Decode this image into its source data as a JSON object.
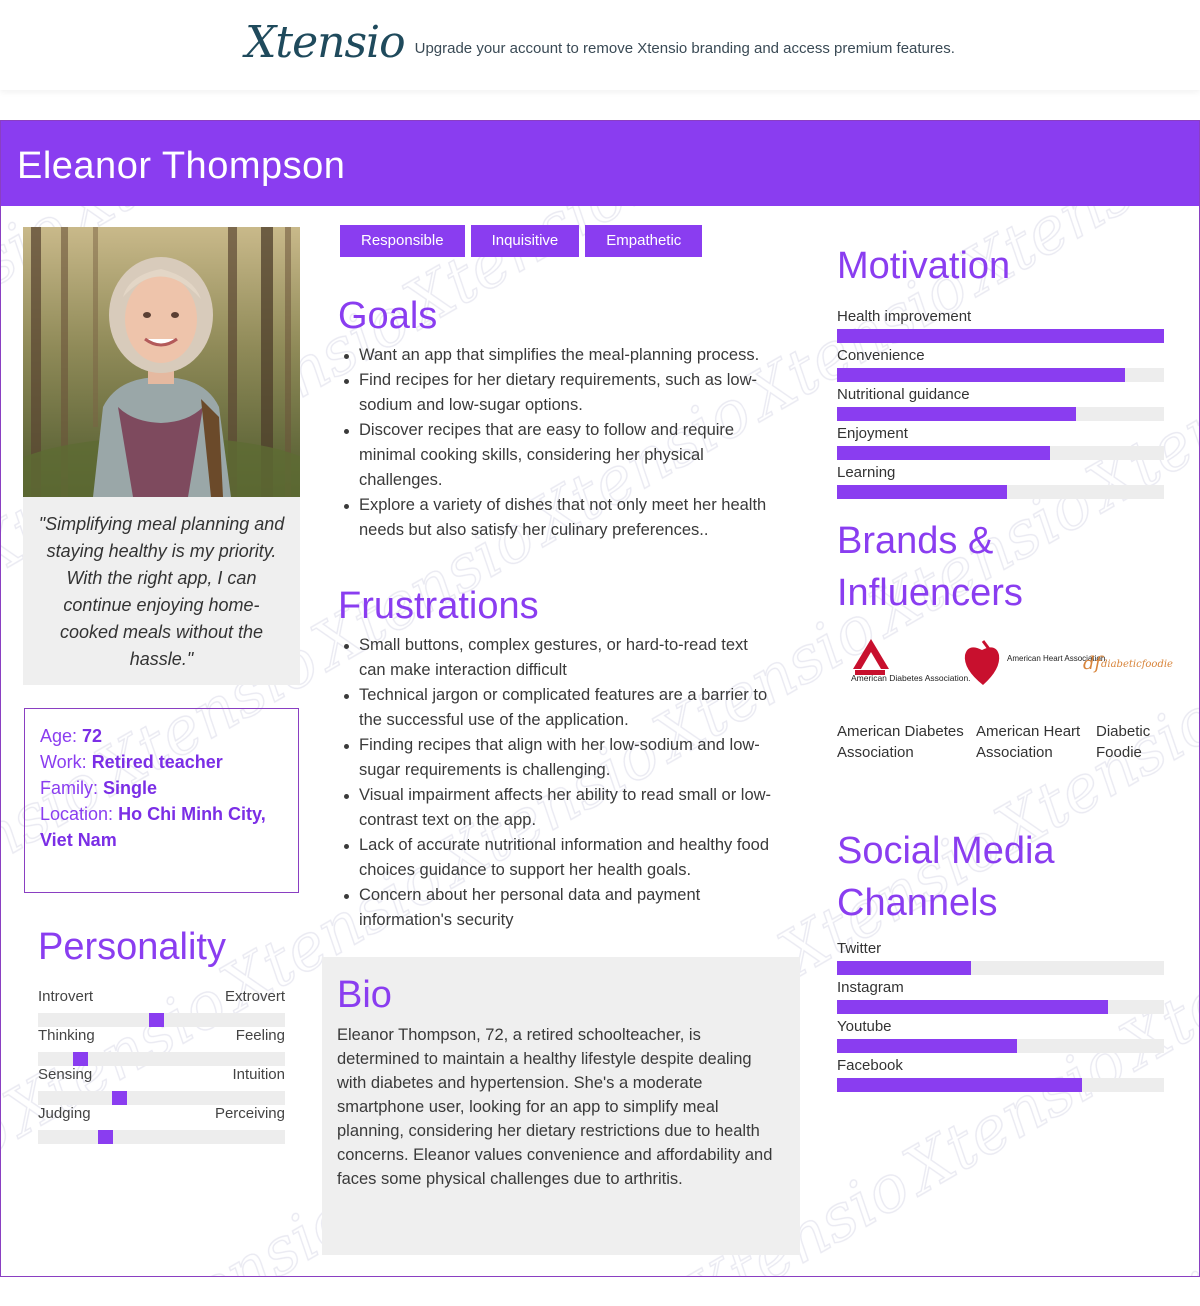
{
  "banner": {
    "logo_text": "Xtensio",
    "message": "Upgrade your account to remove Xtensio branding and access premium features."
  },
  "persona": {
    "name": "Eleanor Thompson",
    "quote": "\"Simplifying meal planning and staying healthy is my priority. With the right app, I can continue enjoying home-cooked meals without the hassle.\"",
    "info": {
      "age_label": "Age:",
      "age": "72",
      "work_label": "Work:",
      "work": "Retired teacher",
      "family_label": "Family:",
      "family": "Single",
      "location_label": "Location:",
      "location": "Ho Chi Minh City, Viet Nam"
    },
    "tags": [
      "Responsible",
      "Inquisitive",
      "Empathetic"
    ]
  },
  "personality": {
    "title": "Personality",
    "traits": [
      {
        "left": "Introvert",
        "right": "Extrovert",
        "position": 0.48
      },
      {
        "left": "Thinking",
        "right": "Feeling",
        "position": 0.15
      },
      {
        "left": "Sensing",
        "right": "Intuition",
        "position": 0.32
      },
      {
        "left": "Judging",
        "right": "Perceiving",
        "position": 0.26
      }
    ]
  },
  "goals": {
    "title": "Goals",
    "items": [
      "Want an app that simplifies the meal-planning process.",
      "Find recipes for her dietary requirements, such as low-sodium and low-sugar options.",
      "Discover recipes that are easy to follow and require minimal cooking skills, considering her physical challenges.",
      "Explore a variety of dishes that not only meet her health needs but also satisfy her culinary preferences.."
    ]
  },
  "frustrations": {
    "title": "Frustrations",
    "items": [
      "Small buttons, complex gestures, or hard-to-read text can make interaction difficult",
      "Technical jargon or complicated features are a barrier to the successful use of the application.",
      "Finding recipes that align with her low-sodium and low-sugar requirements is challenging.",
      "Visual impairment affects her ability to read small or low-contrast text on the app.",
      "Lack of accurate nutritional information and healthy food choices guidance to support her health goals.",
      "Concern about her personal data and payment information's security"
    ]
  },
  "bio": {
    "title": "Bio",
    "text": "Eleanor Thompson, 72, a retired schoolteacher, is determined to maintain a healthy lifestyle despite dealing with diabetes and hypertension. She's a moderate smartphone user, looking for an app to simplify meal planning, considering her dietary restrictions due to health concerns. Eleanor values convenience and affordability and faces some physical challenges due to arthritis."
  },
  "motivation": {
    "title": "Motivation",
    "items": [
      {
        "label": "Health improvement",
        "value": 1.0
      },
      {
        "label": "Convenience",
        "value": 0.88
      },
      {
        "label": "Nutritional guidance",
        "value": 0.73
      },
      {
        "label": "Enjoyment",
        "value": 0.65
      },
      {
        "label": "Learning",
        "value": 0.52
      }
    ]
  },
  "brands": {
    "title_line1": "Brands &",
    "title_line2": "Influencers",
    "logo_text": {
      "ada": "American Diabetes Association.",
      "aha": "American Heart Association.",
      "df": "diabeticfoodie"
    },
    "items": [
      {
        "name": "American Diabetes Association"
      },
      {
        "name": "American Heart Association"
      },
      {
        "name": "Diabetic Foodie"
      }
    ]
  },
  "social": {
    "title_line1": "Social Media",
    "title_line2": "Channels",
    "items": [
      {
        "label": "Twitter",
        "value": 0.41
      },
      {
        "label": "Instagram",
        "value": 0.83
      },
      {
        "label": "Youtube",
        "value": 0.55
      },
      {
        "label": "Facebook",
        "value": 0.75
      }
    ]
  },
  "colors": {
    "accent": "#8a3df0",
    "brand_logo": "#1f4a5c",
    "panel_bg": "#efefef"
  }
}
